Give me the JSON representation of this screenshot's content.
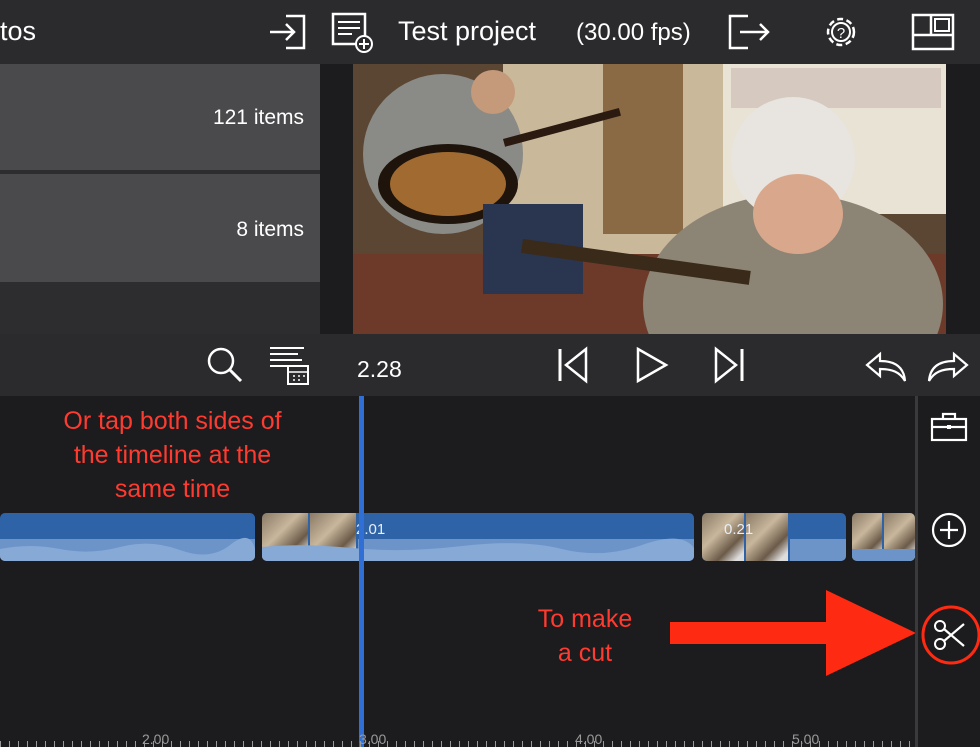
{
  "topbar": {
    "left_title": "tos",
    "project_title": "Test project",
    "fps": "(30.00 fps)"
  },
  "library": {
    "rows": [
      {
        "count": "121 items"
      },
      {
        "count": "8 items"
      }
    ]
  },
  "transport": {
    "time": "2.28"
  },
  "annotations": {
    "tap_both": [
      "Or tap both sides of",
      "the timeline at the",
      "same time"
    ],
    "make_cut": [
      "To make",
      "a cut"
    ]
  },
  "clips": [
    {
      "label": ""
    },
    {
      "label": "2.01"
    },
    {
      "label": "0.21"
    },
    {
      "label": ""
    }
  ],
  "ruler": {
    "labels": [
      "2.00",
      "3.00",
      "4.00",
      "5.00"
    ]
  },
  "colors": {
    "accent_blue": "#2f6fd6",
    "annotation_red": "#ff3b30",
    "clip_blue": "#2f63a8"
  }
}
